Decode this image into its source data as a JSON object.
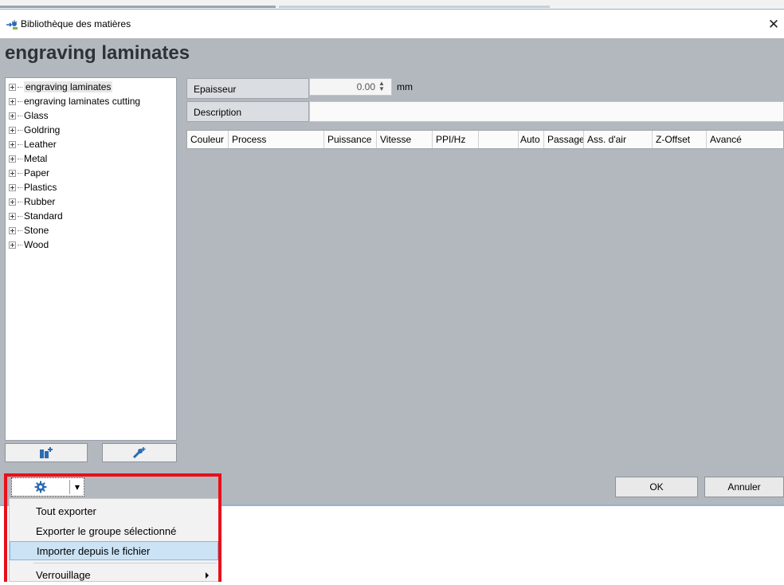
{
  "window": {
    "title": "Bibliothèque des matières",
    "close_glyph": "✕"
  },
  "header": {
    "title": "engraving laminates"
  },
  "tree": {
    "items": [
      {
        "label": "engraving laminates",
        "selected": true
      },
      {
        "label": "engraving laminates cutting"
      },
      {
        "label": "Glass"
      },
      {
        "label": "Goldring"
      },
      {
        "label": "Leather"
      },
      {
        "label": "Metal"
      },
      {
        "label": "Paper"
      },
      {
        "label": "Plastics"
      },
      {
        "label": "Rubber"
      },
      {
        "label": "Standard"
      },
      {
        "label": "Stone"
      },
      {
        "label": "Wood"
      }
    ]
  },
  "form": {
    "thickness_label": "Epaisseur",
    "thickness_value": "0.00",
    "thickness_unit": "mm",
    "description_label": "Description",
    "description_value": ""
  },
  "grid": {
    "columns": [
      "Couleur",
      "Process",
      "Puissance",
      "Vitesse",
      "PPI/Hz",
      "",
      "Auto",
      "Passage",
      "Ass. d'air",
      "Z-Offset",
      "Avancé"
    ]
  },
  "buttons": {
    "ok": "OK",
    "cancel": "Annuler"
  },
  "menu": {
    "items": [
      {
        "label": "Tout exporter"
      },
      {
        "label": "Exporter le groupe sélectionné"
      },
      {
        "label": "Importer depuis le fichier",
        "highlighted": true
      },
      {
        "label": "Verrouillage",
        "has_submenu": true
      }
    ]
  },
  "icons": {
    "app": "material-library-icon",
    "add_material": "add-material-icon",
    "add_process": "add-process-icon",
    "gear": "gear-icon"
  },
  "colors": {
    "panel_bg": "#b3b7be",
    "highlight_frame": "#e8101a",
    "menu_highlight": "#cbe3f5",
    "icon_blue": "#2b6cb3"
  }
}
